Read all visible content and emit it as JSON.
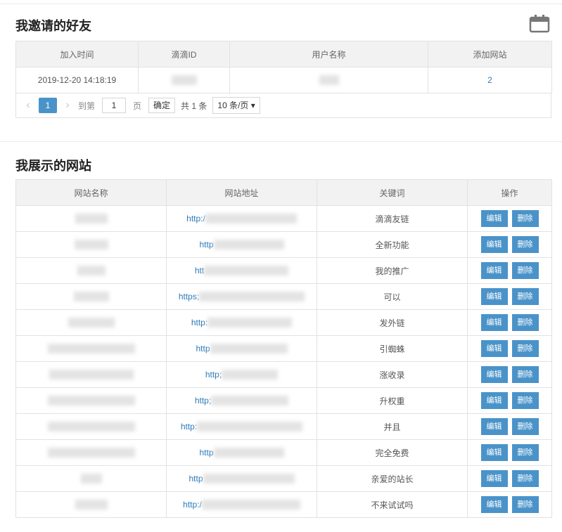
{
  "friends": {
    "title": "我邀请的好友",
    "columns": [
      "加入时间",
      "滴滴ID",
      "用户名称",
      "添加网站"
    ],
    "rows": [
      {
        "time": "2019-12-20 14:18:19",
        "didi_id": "",
        "username": "",
        "sites": "2"
      }
    ],
    "pager": {
      "prev": "‹",
      "current": "1",
      "next": "›",
      "goto_label": "到第",
      "goto_value": "1",
      "page_label": "页",
      "confirm": "确定",
      "total": "共 1 条",
      "page_size": "10 条/页 ▾"
    }
  },
  "sites": {
    "title": "我展示的网站",
    "columns": [
      "网站名称",
      "网站地址",
      "关键词",
      "操作"
    ],
    "edit_label": "编辑",
    "delete_label": "删除",
    "rows": [
      {
        "name": "",
        "url": "http:/",
        "keyword": "滴滴友链"
      },
      {
        "name": "",
        "url": "http",
        "keyword": "全新功能"
      },
      {
        "name": "",
        "url": "htt",
        "keyword": "我的推广"
      },
      {
        "name": "",
        "url": "https;",
        "keyword": "可以"
      },
      {
        "name": "",
        "url": "http:",
        "keyword": "发外链"
      },
      {
        "name": "",
        "url": "http",
        "keyword": "引蜘蛛"
      },
      {
        "name": "",
        "url": "http;",
        "keyword": "涨收录"
      },
      {
        "name": "",
        "url": "http;",
        "keyword": "升权重"
      },
      {
        "name": "",
        "url": "http:",
        "keyword": "并且"
      },
      {
        "name": "",
        "url": "http",
        "keyword": "完全免费"
      },
      {
        "name": "",
        "url": "http",
        "keyword": "亲爱的站长"
      },
      {
        "name": "",
        "url": "http:/",
        "keyword": "不来试试吗"
      }
    ]
  },
  "icons": {
    "calendar": "calendar-icon"
  },
  "colors": {
    "accent": "#4a93c9",
    "link": "#2d7ab8",
    "header_bg": "#f2f2f2"
  }
}
